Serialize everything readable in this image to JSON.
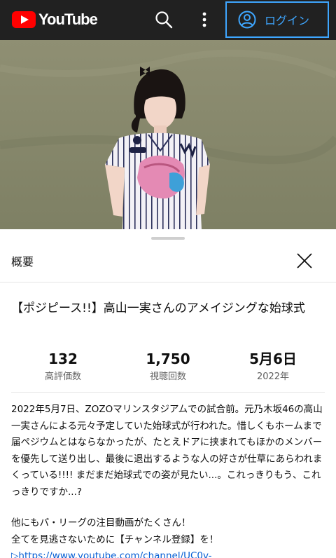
{
  "header": {
    "logo_text": "YouTube",
    "login_label": "ログイン",
    "icons": [
      "youtube-logo-icon",
      "search-icon",
      "more-vert-icon",
      "account-circle-icon"
    ],
    "accent": "#3ea6ff",
    "bg": "#212121"
  },
  "panel": {
    "title": "概要",
    "video_title": "【ポジピース!!】高山一実さんのアメイジングな始球式",
    "stats": [
      {
        "value": "132",
        "label": "高評価数"
      },
      {
        "value": "1,750",
        "label": "視聴回数"
      },
      {
        "value": "5月6日",
        "label": "2022年"
      }
    ],
    "description": "2022年5月7日、ZOZOマリンスタジアムでの試合前。元乃木坂46の高山一実さんによる元々予定していた始球式が行われた。惜しくもホームまで届ペジウムとはならなかったが、たとえドアに挟まれてもほかのメンバーを優先して送り出し、最後に退出するような人の好さが仕草にあらわれまくっている!!!! まだまだ始球式での姿が見たい...。これっきりもう、これっきりですか...?",
    "description2_line1": "他にもパ・リーグの注目動画がたくさん！",
    "description2_line2": "全てを見逃さないために【チャンネル登録】を！",
    "link": "▷https://www.youtube.com/channel/UC0v-"
  }
}
